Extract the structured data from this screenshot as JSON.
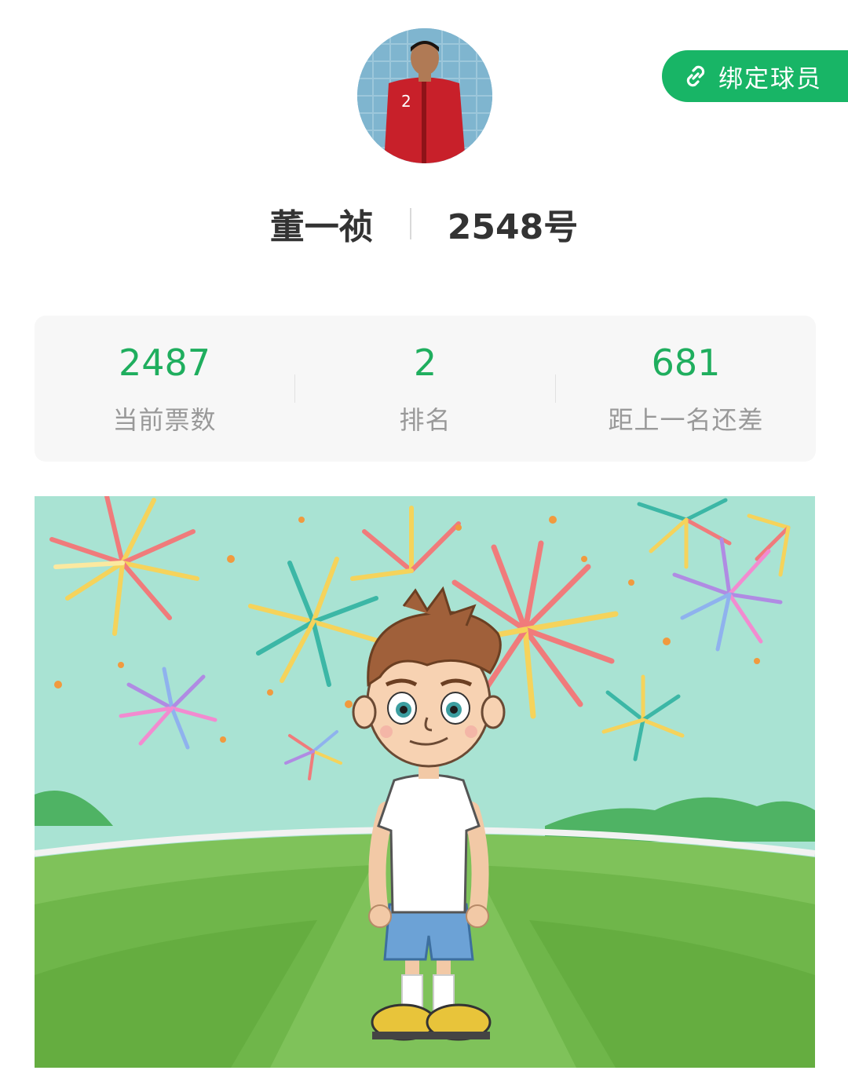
{
  "header": {
    "bind_button_label": "绑定球员",
    "bind_icon": "link-icon"
  },
  "player": {
    "name": "董一祯",
    "number": "2548号",
    "avatar_icon": "player-photo"
  },
  "stats": [
    {
      "value": "2487",
      "label": "当前票数"
    },
    {
      "value": "2",
      "label": "排名"
    },
    {
      "value": "681",
      "label": "距上一名还差"
    }
  ],
  "colors": {
    "accent": "#18b566",
    "stat_number": "#1fae5e",
    "stat_label": "#999999",
    "name_text": "#333333",
    "card_bg": "#f7f7f7",
    "scene_sky": "#a9e3d3",
    "scene_grass": "#6fb64a"
  },
  "illustration": {
    "icon": "cartoon-boy-fireworks-field"
  }
}
